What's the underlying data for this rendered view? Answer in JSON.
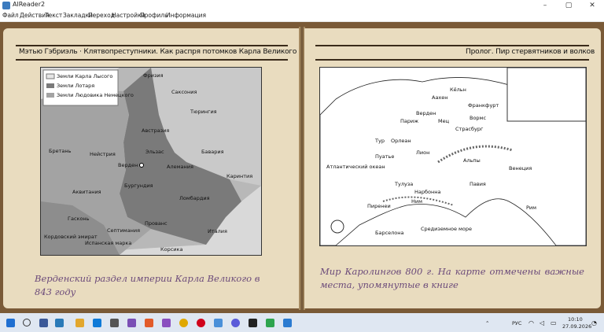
{
  "window": {
    "title": "AlReader2",
    "min": "–",
    "max": "▢",
    "close": "✕"
  },
  "menu": [
    "Файл",
    "Действия",
    "Текст",
    "Закладки",
    "Переход",
    "Настройки",
    "Профиль",
    "Информация"
  ],
  "left_page": {
    "header": "Мэтью Гэбриэль · Клятвопреступники. Как распря потомков Карла Великого создала сред...",
    "caption": "Верденский раздел империи Карла Великого в 843 году",
    "map": {
      "legend": [
        "Земли Карла Лысого",
        "Земли Лотаря",
        "Земли Людовика Немецкого"
      ],
      "labels": [
        "Фризия",
        "Саксония",
        "Тюрингия",
        "Австразия",
        "Верден",
        "Эльзас",
        "Бавария",
        "Бретань",
        "Нейстрия",
        "Алемания",
        "Каринтия",
        "Бургундия",
        "Аквитания",
        "Ломбардия",
        "Гасконь",
        "Септимания",
        "Прованс",
        "Италия",
        "Кордовский эмират",
        "Испанская марка",
        "Корсика"
      ]
    }
  },
  "right_page": {
    "header": "Пролог. Пир стервятников и волков",
    "caption": "Мир Каролингов 800 г. На карте отмечены важные места, упомянутые в книге",
    "map": {
      "labels": [
        "Атлантический океан",
        "Средиземное море",
        "Пиренеи",
        "Альпы",
        "Рим",
        "Павия",
        "Франкфурт",
        "Аахен",
        "Париж",
        "Мец",
        "Пуатье",
        "Тулуза",
        "Нарбонна",
        "Барселона",
        "Лион",
        "Кёльн",
        "Верден",
        "Страсбург",
        "Вормс",
        "Венеция",
        "Ним",
        "Орлеан",
        "Тур"
      ]
    }
  },
  "tray": {
    "lang": "РУС",
    "time": "10:10",
    "date": "27.09.2026"
  }
}
